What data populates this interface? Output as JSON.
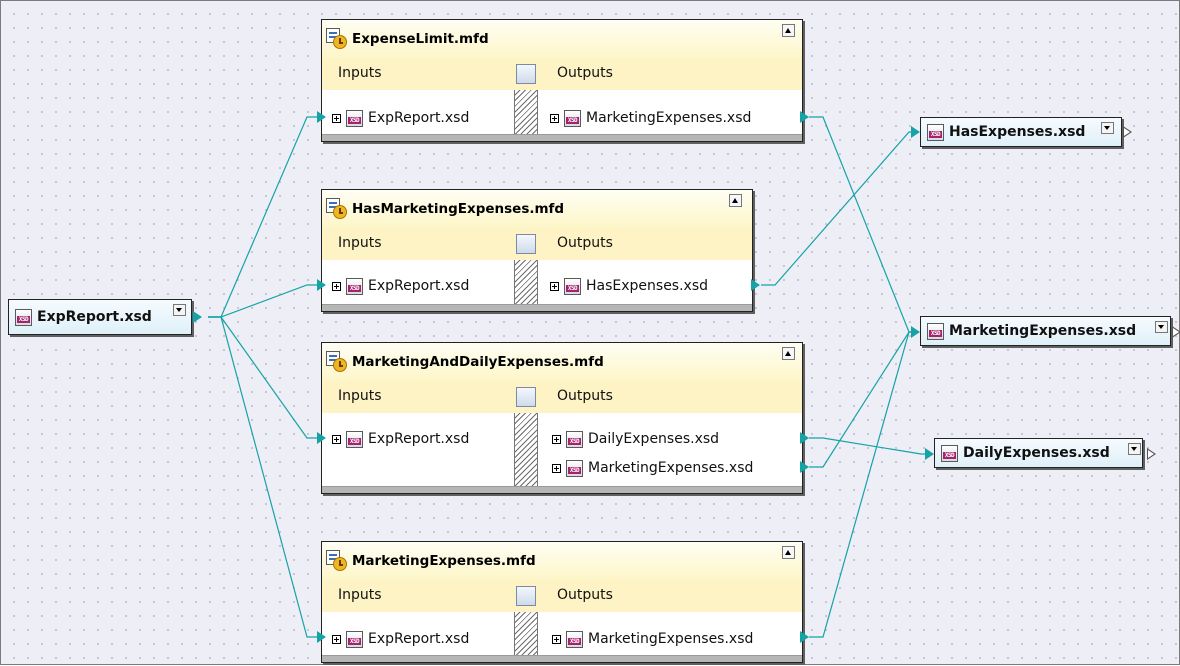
{
  "source": {
    "label": "ExpReport.xsd"
  },
  "mappings": [
    {
      "title": "ExpenseLimit.mfd",
      "inputs_label": "Inputs",
      "outputs_label": "Outputs",
      "inputs": [
        "ExpReport.xsd"
      ],
      "outputs": [
        "MarketingExpenses.xsd"
      ]
    },
    {
      "title": "HasMarketingExpenses.mfd",
      "inputs_label": "Inputs",
      "outputs_label": "Outputs",
      "inputs": [
        "ExpReport.xsd"
      ],
      "outputs": [
        "HasExpenses.xsd"
      ]
    },
    {
      "title": "MarketingAndDailyExpenses.mfd",
      "inputs_label": "Inputs",
      "outputs_label": "Outputs",
      "inputs": [
        "ExpReport.xsd"
      ],
      "outputs": [
        "DailyExpenses.xsd",
        "MarketingExpenses.xsd"
      ]
    },
    {
      "title": "MarketingExpenses.mfd",
      "inputs_label": "Inputs",
      "outputs_label": "Outputs",
      "inputs": [
        "ExpReport.xsd"
      ],
      "outputs": [
        "MarketingExpenses.xsd"
      ]
    }
  ],
  "targets": [
    {
      "label": "HasExpenses.xsd"
    },
    {
      "label": "MarketingExpenses.xsd"
    },
    {
      "label": "DailyExpenses.xsd"
    }
  ],
  "colors": {
    "wire": "#16a3a6",
    "title_bg": "#fdf6c8",
    "io_bg": "#dff0f8",
    "schema_badge": "#a3246d"
  },
  "icons": {
    "schema": "xsd-file-icon",
    "mapping": "mfd-mapping-icon"
  }
}
